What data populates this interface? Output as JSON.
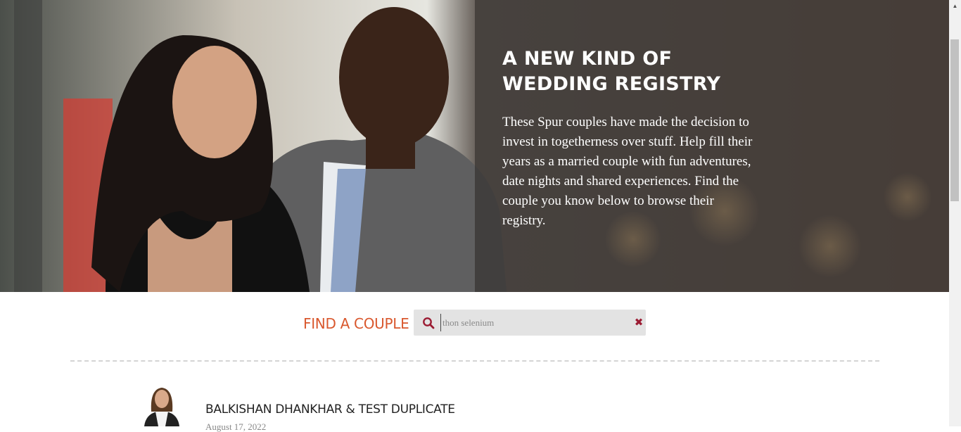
{
  "hero": {
    "title_line1": "A NEW KIND OF",
    "title_line2": "WEDDING REGISTRY",
    "description": "These Spur couples have made the decision to invest in togetherness over stuff. Help fill their years as a married couple with fun adventures, date nights and shared experiences. Find the couple you know below to browse their registry."
  },
  "search": {
    "label": "FIND A COUPLE",
    "value": "thon selenium",
    "icon": "search-icon",
    "clear_icon": "close-icon"
  },
  "results": [
    {
      "names": "BALKISHAN DHANKHAR & TEST DUPLICATE",
      "date": "August 17, 2022"
    }
  ],
  "colors": {
    "accent": "#d9582e",
    "clear": "#9b1b32",
    "search_bg": "#e3e3e3"
  }
}
